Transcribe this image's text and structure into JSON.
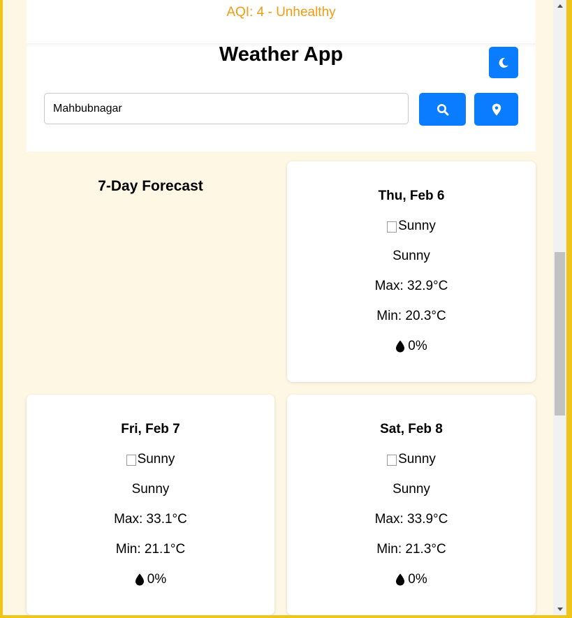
{
  "header": {
    "aqi_text": "AQI: 4 - Unhealthy",
    "title": "Weather App",
    "theme_toggle_icon": "moon-icon",
    "search": {
      "value": "Mahbubnagar",
      "search_icon": "search-icon",
      "location_icon": "map-pin-icon"
    }
  },
  "forecast": {
    "title": "7-Day Forecast",
    "days": [
      {
        "day": "Thu, Feb 6",
        "image_alt": "Sunny",
        "condition": "Sunny",
        "max": "Max: 32.9°C",
        "min": "Min: 20.3°C",
        "precip": "0%"
      },
      {
        "day": "Fri, Feb 7",
        "image_alt": "Sunny",
        "condition": "Sunny",
        "max": "Max: 33.1°C",
        "min": "Min: 21.1°C",
        "precip": "0%"
      },
      {
        "day": "Sat, Feb 8",
        "image_alt": "Sunny",
        "condition": "Sunny",
        "max": "Max: 33.9°C",
        "min": "Min: 21.3°C",
        "precip": "0%"
      }
    ]
  },
  "colors": {
    "accent": "#0a7cff",
    "aqi": "#f39c12",
    "frame": "#f0c419",
    "background": "#fef7e4"
  }
}
